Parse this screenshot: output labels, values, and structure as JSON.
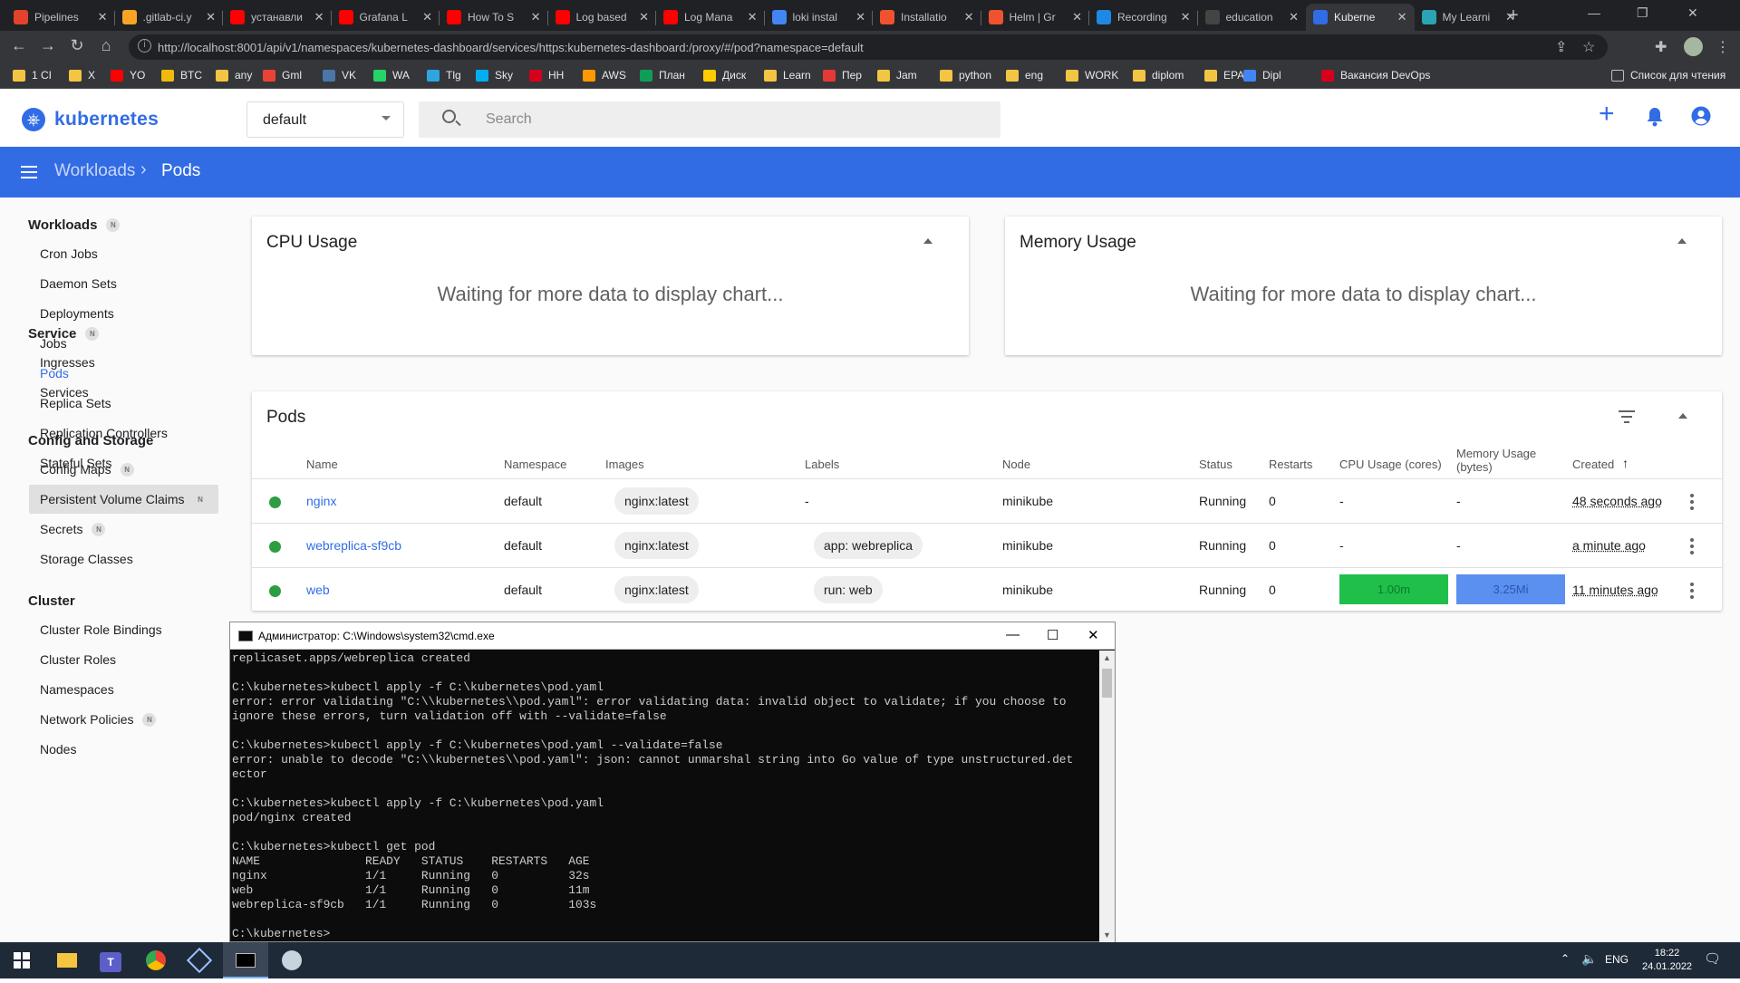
{
  "browser": {
    "tabs": [
      {
        "title": "Pipelines",
        "color": "#e2432a"
      },
      {
        "title": ".gitlab-ci.y",
        "color": "#fca326"
      },
      {
        "title": "устанавли",
        "color": "#ff0000"
      },
      {
        "title": "Grafana L",
        "color": "#ff0000"
      },
      {
        "title": "How To S",
        "color": "#ff0000"
      },
      {
        "title": "Log based",
        "color": "#ff0000"
      },
      {
        "title": "Log Mana",
        "color": "#ff0000"
      },
      {
        "title": "loki instal",
        "color": "#4285f4"
      },
      {
        "title": "Installatio",
        "color": "#f0522f"
      },
      {
        "title": "Helm | Gr",
        "color": "#f0522f"
      },
      {
        "title": "Recording",
        "color": "#1e88e5"
      },
      {
        "title": "education",
        "color": "#444444"
      },
      {
        "title": "Kuberne",
        "color": "#326ce5"
      },
      {
        "title": "My Learni",
        "color": "#2aa4b5"
      }
    ],
    "url": "http://localhost:8001/api/v1/namespaces/kubernetes-dashboard/services/https:kubernetes-dashboard:/proxy/#/pod?namespace=default",
    "bookmarks": [
      {
        "label": "1 CI",
        "color": "#f4c542"
      },
      {
        "label": "X",
        "color": "#f4c542"
      },
      {
        "label": "YO",
        "color": "#ff0000"
      },
      {
        "label": "BTC",
        "color": "#f0b90b"
      },
      {
        "label": "any",
        "color": "#f4c542"
      },
      {
        "label": "Gml",
        "color": "#ea4335"
      },
      {
        "label": "VK",
        "color": "#4a76a8"
      },
      {
        "label": "WA",
        "color": "#25d366"
      },
      {
        "label": "Tlg",
        "color": "#2ca5e0"
      },
      {
        "label": "Sky",
        "color": "#00aff0"
      },
      {
        "label": "HH",
        "color": "#d6001c"
      },
      {
        "label": "AWS",
        "color": "#ff9900"
      },
      {
        "label": "План",
        "color": "#0f9d58"
      },
      {
        "label": "Диск",
        "color": "#ffcc00"
      },
      {
        "label": "Learn",
        "color": "#f4c542"
      },
      {
        "label": "Пер",
        "color": "#e53935"
      },
      {
        "label": "Jam",
        "color": "#f4c542"
      },
      {
        "label": "python",
        "color": "#f4c542"
      },
      {
        "label": "eng",
        "color": "#f4c542"
      },
      {
        "label": "WORK",
        "color": "#f4c542"
      },
      {
        "label": "diplom",
        "color": "#f4c542"
      },
      {
        "label": "EPAM",
        "color": "#f4c542"
      },
      {
        "label": "Dipl",
        "color": "#4285f4"
      },
      {
        "label": "Вакансия DevOps",
        "color": "#d6001c"
      }
    ],
    "reading_list": "Список для чтения"
  },
  "k8s": {
    "title": "kubernetes",
    "namespace": "default",
    "search_placeholder": "Search",
    "breadcrumb": {
      "parent": "Workloads",
      "current": "Pods"
    },
    "accent": "#326ce5"
  },
  "sidebar": {
    "sections": [
      {
        "title": "Workloads",
        "badge": "N",
        "items": [
          {
            "label": "Cron Jobs"
          },
          {
            "label": "Daemon Sets"
          },
          {
            "label": "Deployments"
          },
          {
            "label": "Jobs"
          },
          {
            "label": "Pods",
            "selected": true
          },
          {
            "label": "Replica Sets"
          },
          {
            "label": "Replication Controllers"
          },
          {
            "label": "Stateful Sets"
          }
        ]
      },
      {
        "title": "Service",
        "badge": "N",
        "items": [
          {
            "label": "Ingresses"
          },
          {
            "label": "Services"
          }
        ]
      },
      {
        "title": "Config and Storage",
        "items": [
          {
            "label": "Config Maps",
            "badge": "N"
          },
          {
            "label": "Persistent Volume Claims",
            "badge": "N"
          },
          {
            "label": "Secrets",
            "badge": "N"
          },
          {
            "label": "Storage Classes"
          }
        ]
      },
      {
        "title": "Cluster",
        "items": [
          {
            "label": "Cluster Role Bindings"
          },
          {
            "label": "Cluster Roles"
          },
          {
            "label": "Namespaces"
          },
          {
            "label": "Network Policies",
            "badge": "N"
          },
          {
            "label": "Nodes"
          }
        ]
      }
    ]
  },
  "cpu_card": {
    "title": "CPU Usage",
    "message": "Waiting for more data to display chart..."
  },
  "mem_card": {
    "title": "Memory Usage",
    "message": "Waiting for more data to display chart..."
  },
  "pods": {
    "title": "Pods",
    "columns": [
      "Name",
      "Namespace",
      "Images",
      "Labels",
      "Node",
      "Status",
      "Restarts",
      "CPU Usage (cores)",
      "Memory Usage (bytes)",
      "Created"
    ],
    "rows": [
      {
        "name": "nginx",
        "namespace": "default",
        "image": "nginx:latest",
        "labels": "-",
        "node": "minikube",
        "status": "Running",
        "restarts": "0",
        "cpu": "-",
        "memory": "-",
        "created": "48 seconds ago"
      },
      {
        "name": "webreplica-sf9cb",
        "namespace": "default",
        "image": "nginx:latest",
        "labels": "app: webreplica",
        "node": "minikube",
        "status": "Running",
        "restarts": "0",
        "cpu": "-",
        "memory": "-",
        "created": "a minute ago"
      },
      {
        "name": "web",
        "namespace": "default",
        "image": "nginx:latest",
        "labels": "run: web",
        "node": "minikube",
        "status": "Running",
        "restarts": "0",
        "cpu": "1.00m",
        "memory": "3.25Mi",
        "created": "11 minutes ago"
      }
    ]
  },
  "cmd": {
    "title": "Администратор: C:\\Windows\\system32\\cmd.exe",
    "lines": [
      "replicaset.apps/webreplica created",
      "",
      "C:\\kubernetes>kubectl apply -f C:\\kubernetes\\pod.yaml",
      "error: error validating \"C:\\\\kubernetes\\\\pod.yaml\": error validating data: invalid object to validate; if you choose to",
      "ignore these errors, turn validation off with --validate=false",
      "",
      "C:\\kubernetes>kubectl apply -f C:\\kubernetes\\pod.yaml --validate=false",
      "error: unable to decode \"C:\\\\kubernetes\\\\pod.yaml\": json: cannot unmarshal string into Go value of type unstructured.det",
      "ector",
      "",
      "C:\\kubernetes>kubectl apply -f C:\\kubernetes\\pod.yaml",
      "pod/nginx created",
      "",
      "C:\\kubernetes>kubectl get pod",
      "NAME               READY   STATUS    RESTARTS   AGE",
      "nginx              1/1     Running   0          32s",
      "web                1/1     Running   0          11m",
      "webreplica-sf9cb   1/1     Running   0          103s",
      "",
      "C:\\kubernetes>"
    ]
  },
  "taskbar": {
    "lang": "ENG",
    "time": "18:22",
    "date": "24.01.2022"
  }
}
